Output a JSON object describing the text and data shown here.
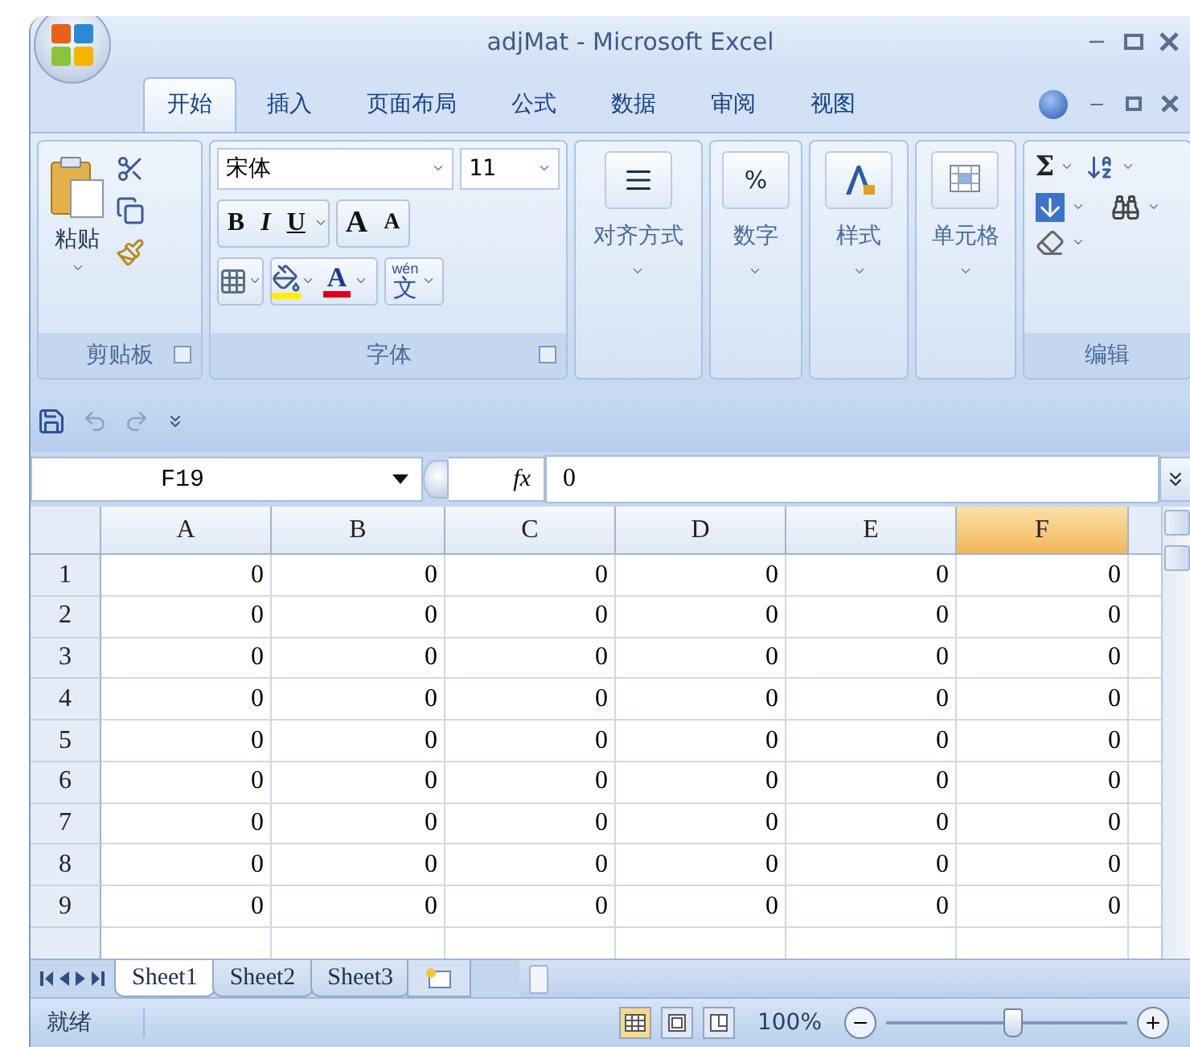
{
  "window": {
    "title": "adjMat - Microsoft Excel"
  },
  "ribbon_tabs": [
    {
      "label": "开始",
      "selected": true
    },
    {
      "label": "插入",
      "selected": false
    },
    {
      "label": "页面布局",
      "selected": false
    },
    {
      "label": "公式",
      "selected": false
    },
    {
      "label": "数据",
      "selected": false
    },
    {
      "label": "审阅",
      "selected": false
    },
    {
      "label": "视图",
      "selected": false
    }
  ],
  "clipboard": {
    "paste_label": "粘贴",
    "group_label": "剪贴板"
  },
  "font": {
    "name": "宋体",
    "size": "11",
    "bold": "B",
    "italic": "I",
    "underline": "U",
    "grow": "A",
    "shrink": "A",
    "font_color": "A",
    "phonetic_ruby": "wén",
    "phonetic_char": "文",
    "group_label": "字体"
  },
  "collapsed_groups": [
    {
      "label": "对齐方式",
      "kind": "align"
    },
    {
      "label": "数字",
      "kind": "number",
      "symbol": "%"
    },
    {
      "label": "样式",
      "kind": "styles"
    },
    {
      "label": "单元格",
      "kind": "cells"
    }
  ],
  "editing": {
    "sum": "Σ",
    "group_label": "编辑"
  },
  "formula_bar": {
    "name_box": "F19",
    "fx": "fx",
    "value": "0"
  },
  "sheet": {
    "columns": [
      {
        "label": "A",
        "selected": false
      },
      {
        "label": "B",
        "selected": false
      },
      {
        "label": "C",
        "selected": false
      },
      {
        "label": "D",
        "selected": false
      },
      {
        "label": "E",
        "selected": false
      },
      {
        "label": "F",
        "selected": true
      }
    ],
    "rows": [
      {
        "label": "1",
        "cells": [
          "0",
          "0",
          "0",
          "0",
          "0",
          "0"
        ]
      },
      {
        "label": "2",
        "cells": [
          "0",
          "0",
          "0",
          "0",
          "0",
          "0"
        ]
      },
      {
        "label": "3",
        "cells": [
          "0",
          "0",
          "0",
          "0",
          "0",
          "0"
        ]
      },
      {
        "label": "4",
        "cells": [
          "0",
          "0",
          "0",
          "0",
          "0",
          "0"
        ]
      },
      {
        "label": "5",
        "cells": [
          "0",
          "0",
          "0",
          "0",
          "0",
          "0"
        ]
      },
      {
        "label": "6",
        "cells": [
          "0",
          "0",
          "0",
          "0",
          "0",
          "0"
        ]
      },
      {
        "label": "7",
        "cells": [
          "0",
          "0",
          "0",
          "0",
          "0",
          "0"
        ]
      },
      {
        "label": "8",
        "cells": [
          "0",
          "0",
          "0",
          "0",
          "0",
          "0"
        ]
      },
      {
        "label": "9",
        "cells": [
          "0",
          "0",
          "0",
          "0",
          "0",
          "0"
        ]
      }
    ]
  },
  "sheet_tabs": [
    {
      "label": "Sheet1",
      "selected": true
    },
    {
      "label": "Sheet2",
      "selected": false
    },
    {
      "label": "Sheet3",
      "selected": false
    }
  ],
  "status_bar": {
    "status": "就绪",
    "zoom": "100%",
    "zoom_slider": {
      "level": 0.52
    }
  }
}
